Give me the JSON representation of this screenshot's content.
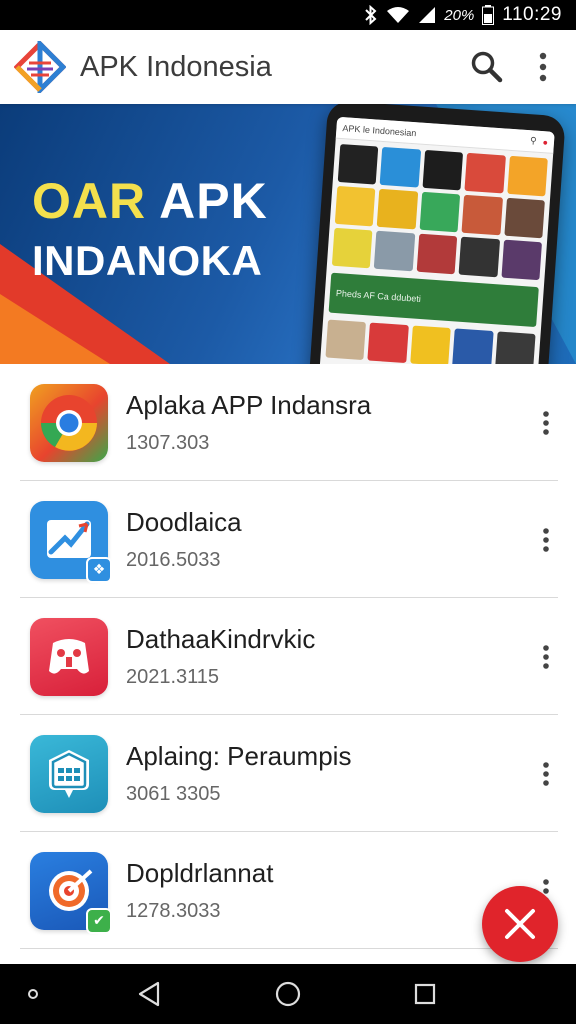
{
  "status_bar": {
    "battery_percent": "20%",
    "time": "110:29",
    "icons": [
      "bluetooth-icon",
      "wifi-icon",
      "signal-icon",
      "battery-icon"
    ]
  },
  "app_bar": {
    "title": "APK Indonesia",
    "actions": [
      "search-icon",
      "more-vert-icon"
    ]
  },
  "banner": {
    "headline_accent": "OAR",
    "headline_rest": "APK",
    "headline_line2": "INDANOKA",
    "phone_title": "APK le Indonesian",
    "phone_strip_text": "Pheds AF Ca ddubeti"
  },
  "apps": [
    {
      "name": "Aplaka APP Indansra",
      "sub": "1307.303",
      "icon": "chrome-icon",
      "color": "#e8442e"
    },
    {
      "name": "Doodlaica",
      "sub": "2016.5033",
      "icon": "chart-app-icon",
      "color": "#2f8fe0"
    },
    {
      "name": "DathaaKindrvkic",
      "sub": "2021.3115",
      "icon": "game-controller-icon",
      "color": "#e33a45"
    },
    {
      "name": "Aplaing: Peraumpis",
      "sub": "3061 3305",
      "icon": "calendar-bubble-icon",
      "color": "#2ba5c9"
    },
    {
      "name": "Dopldrlannat",
      "sub": "1278.3033",
      "icon": "target-icon",
      "color": "#1e6fd0"
    }
  ],
  "fab": {
    "icon": "close-icon",
    "color": "#e0242b"
  },
  "nav_bar": {
    "buttons": [
      "dot-button",
      "back-button",
      "home-button",
      "recents-button"
    ]
  },
  "colors": {
    "accent_yellow": "#f4e04d",
    "banner_blue": "#1c5aa6",
    "fab_red": "#e0242b"
  }
}
